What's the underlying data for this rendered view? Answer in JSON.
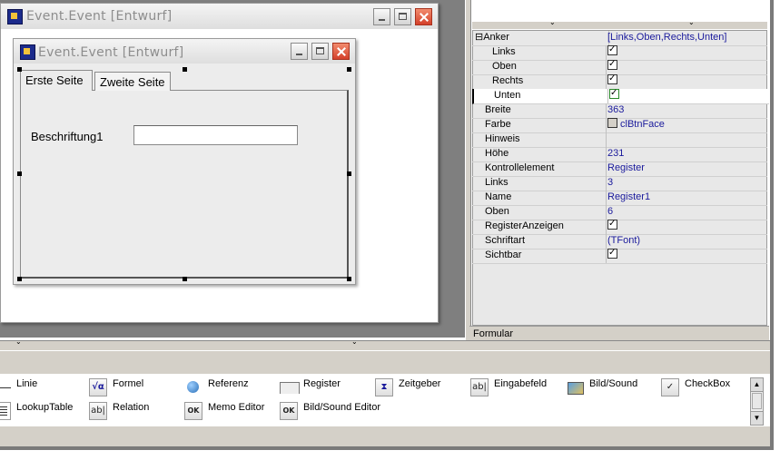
{
  "outer_window": {
    "title": "Event.Event [Entwurf]"
  },
  "inner_window": {
    "title": "Event.Event [Entwurf]"
  },
  "tabs": [
    "Erste Seite",
    "Zweite Seite"
  ],
  "form": {
    "label": "Beschriftung1",
    "input_value": ""
  },
  "props": {
    "anker": {
      "name": "Anker",
      "value": "[Links,Oben,Rechts,Unten]",
      "toggle": "⊟"
    },
    "rows": [
      {
        "name": "Links",
        "value": ""
      },
      {
        "name": "Oben",
        "value": ""
      },
      {
        "name": "Rechts",
        "value": ""
      },
      {
        "name": "Unten",
        "value": ""
      },
      {
        "name": "Breite",
        "value": "363"
      },
      {
        "name": "Farbe",
        "value": "clBtnFace"
      },
      {
        "name": "Hinweis",
        "value": ""
      },
      {
        "name": "Höhe",
        "value": "231"
      },
      {
        "name": "Kontrollelement",
        "value": "Register"
      },
      {
        "name": "Links",
        "value": "3"
      },
      {
        "name": "Name",
        "value": "Register1"
      },
      {
        "name": "Oben",
        "value": "6"
      },
      {
        "name": "RegisterAnzeigen",
        "value": ""
      },
      {
        "name": "Schriftart",
        "value": "(TFont)"
      },
      {
        "name": "Sichtbar",
        "value": ""
      }
    ],
    "footer": "Formular"
  },
  "palette": {
    "row1": [
      "Linie",
      "Formel",
      "Referenz",
      "Register",
      "Zeitgeber",
      "Eingabefeld",
      "Bild/Sound",
      "CheckBox"
    ],
    "row2": [
      "LookupTable",
      "Relation",
      "Memo Editor",
      "Bild/Sound Editor"
    ],
    "icons": {
      "formel": "√α",
      "eingabefeld": "ab|",
      "relation": "ab|",
      "memo": "OK",
      "bildsound_editor": "OK",
      "zeitgeber": "⧗",
      "checkbox": "✓"
    }
  },
  "colors": {
    "workspace": "#808080",
    "panel": "#d4d0c8",
    "value_text": "#1a1a9c"
  }
}
